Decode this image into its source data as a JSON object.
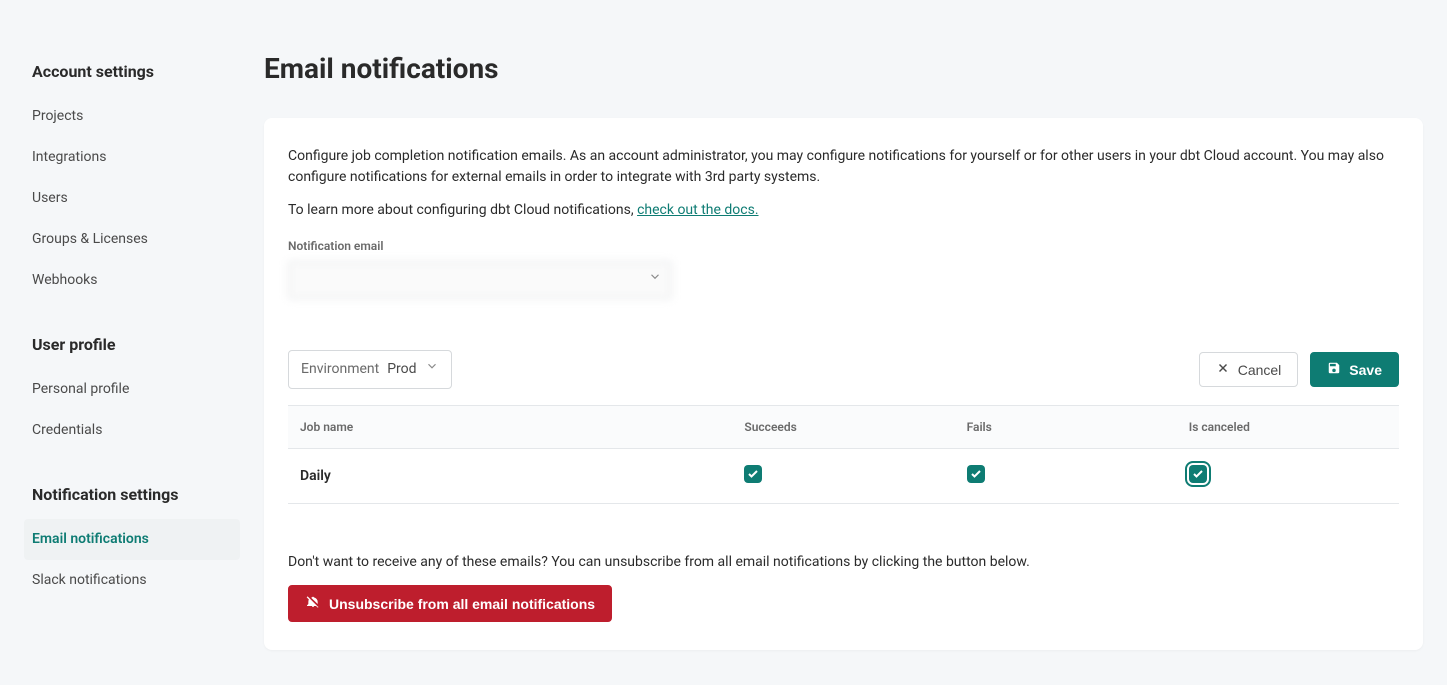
{
  "sidebar": {
    "sections": [
      {
        "heading": "Account settings",
        "items": [
          {
            "label": "Projects"
          },
          {
            "label": "Integrations"
          },
          {
            "label": "Users"
          },
          {
            "label": "Groups & Licenses"
          },
          {
            "label": "Webhooks"
          }
        ]
      },
      {
        "heading": "User profile",
        "items": [
          {
            "label": "Personal profile"
          },
          {
            "label": "Credentials"
          }
        ]
      },
      {
        "heading": "Notification settings",
        "items": [
          {
            "label": "Email notifications"
          },
          {
            "label": "Slack notifications"
          }
        ]
      }
    ]
  },
  "page": {
    "title": "Email notifications",
    "intro": "Configure job completion notification emails. As an account administrator, you may configure notifications for yourself or for other users in your dbt Cloud account. You may also configure notifications for external emails in order to integrate with 3rd party systems.",
    "intro2_prefix": "To learn more about configuring dbt Cloud notifications, ",
    "docs_link_text": "check out the docs."
  },
  "notification_email": {
    "label": "Notification email",
    "value": ""
  },
  "environment": {
    "label": "Environment",
    "value": "Prod"
  },
  "buttons": {
    "cancel": "Cancel",
    "save": "Save",
    "unsubscribe": "Unsubscribe from all email notifications"
  },
  "table": {
    "headers": {
      "job_name": "Job name",
      "succeeds": "Succeeds",
      "fails": "Fails",
      "is_canceled": "Is canceled"
    },
    "rows": [
      {
        "name": "Daily",
        "succeeds": true,
        "fails": true,
        "is_canceled": true
      }
    ]
  },
  "unsubscribe_text": "Don't want to receive any of these emails? You can unsubscribe from all email notifications by clicking the button below."
}
